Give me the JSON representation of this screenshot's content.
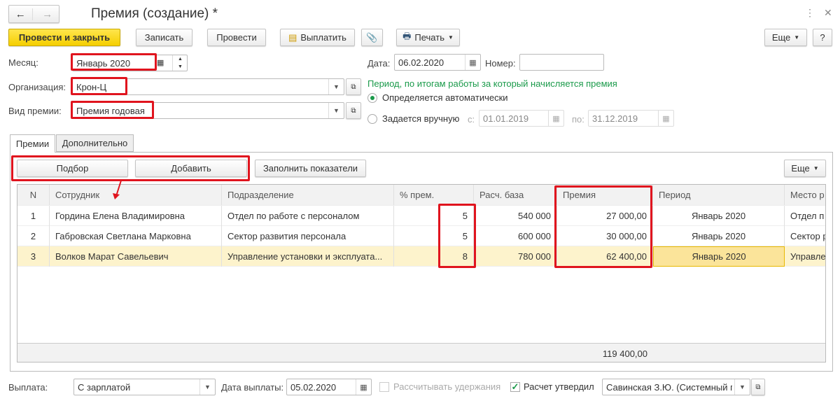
{
  "window": {
    "title": "Премия (создание) *"
  },
  "toolbar": {
    "post_close": "Провести и закрыть",
    "save": "Записать",
    "post": "Провести",
    "pay": "Выплатить",
    "print": "Печать",
    "more": "Еще",
    "help": "?"
  },
  "form": {
    "month_label": "Месяц:",
    "month_value": "Январь 2020",
    "org_label": "Организация:",
    "org_value": "Крон-Ц",
    "bonus_type_label": "Вид премии:",
    "bonus_type_value": "Премия годовая",
    "date_label": "Дата:",
    "date_value": "06.02.2020",
    "number_label": "Номер:",
    "number_value": "",
    "period_title": "Период, по итогам работы за который начисляется премия",
    "period_auto": "Определяется автоматически",
    "period_manual": "Задается вручную",
    "from_label": "с:",
    "from_value": "01.01.2019",
    "to_label": "по:",
    "to_value": "31.12.2019",
    "selected_period_mode": "auto"
  },
  "tabs": [
    {
      "label": "Премии",
      "active": true
    },
    {
      "label": "Дополнительно",
      "active": false
    }
  ],
  "table_toolbar": {
    "pick": "Подбор",
    "add": "Добавить",
    "fill": "Заполнить показатели",
    "more": "Еще"
  },
  "table": {
    "columns": [
      "N",
      "Сотрудник",
      "Подразделение",
      "% прем.",
      "Расч. база",
      "Премия",
      "Период",
      "Место р"
    ],
    "rows": [
      [
        "1",
        "Гордина Елена Владимировна",
        "Отдел по работе с персоналом",
        "5",
        "540 000",
        "27 000,00",
        "Январь 2020",
        "Отдел п"
      ],
      [
        "2",
        "Габровская Светлана Марковна",
        "Сектор развития персонала",
        "5",
        "600 000",
        "30 000,00",
        "Январь 2020",
        "Сектор р"
      ],
      [
        "3",
        "Волков Марат Савельевич",
        "Управление установки и эксплуата...",
        "8",
        "780 000",
        "62 400,00",
        "Январь 2020",
        "Управле"
      ]
    ],
    "selected_row": 3,
    "total_bonus": "119 400,00"
  },
  "footer": {
    "payment_label": "Выплата:",
    "payment_value": "С зарплатой",
    "pay_date_label": "Дата выплаты:",
    "pay_date_value": "05.02.2020",
    "calc_deductions": "Рассчитывать удержания",
    "calc_deductions_checked": false,
    "approved_label": "Расчет утвердил",
    "approved_checked": true,
    "approved_by": "Савинская З.Ю. (Системный п"
  },
  "colors": {
    "accent_yellow": "#f5cf00",
    "highlight": "#e0141e",
    "green": "#1a9a4a",
    "selected_row": "#fdf3cc"
  }
}
